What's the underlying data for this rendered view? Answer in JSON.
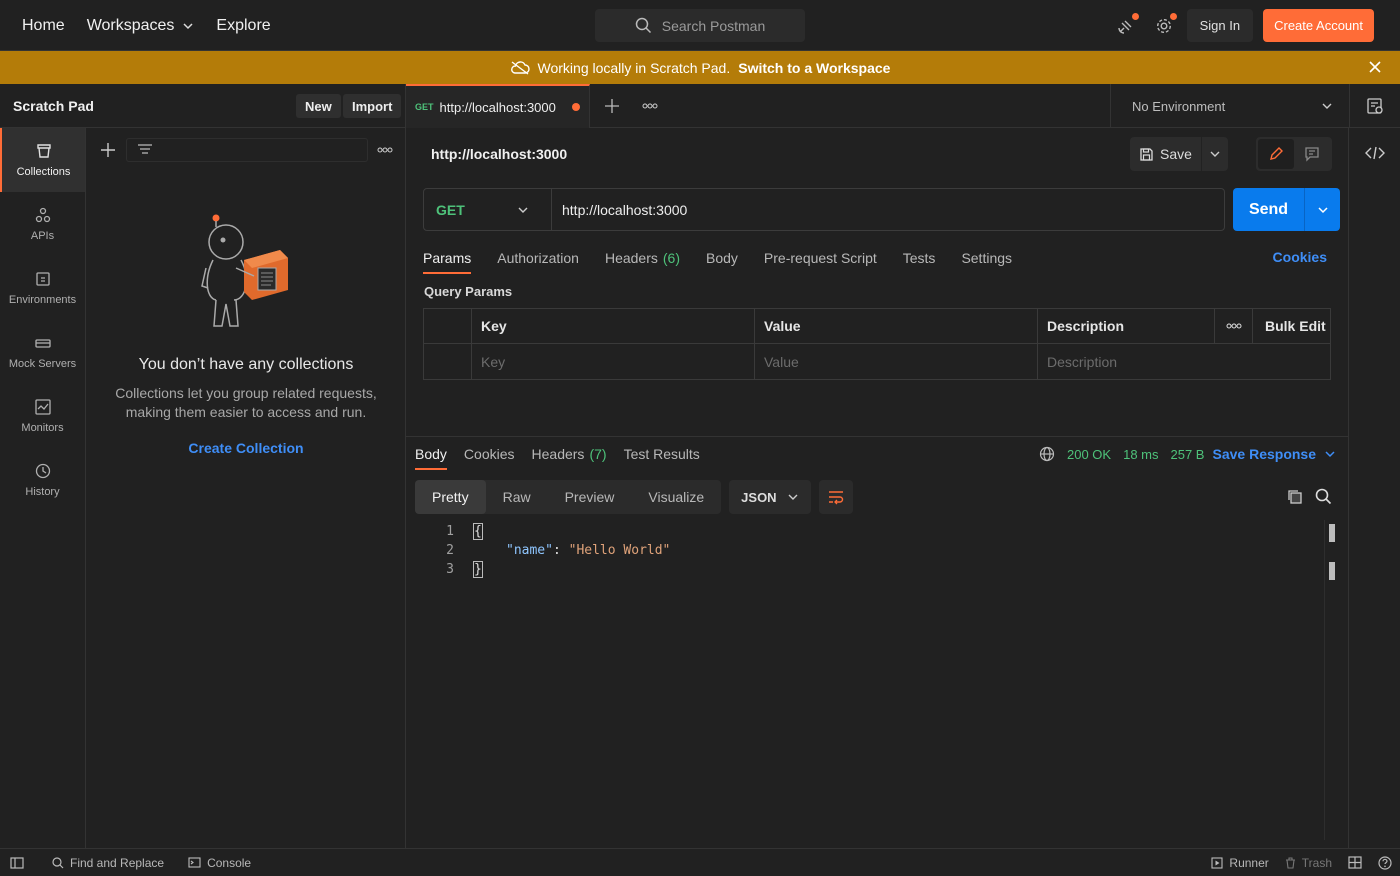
{
  "topbar": {
    "nav": {
      "home": "Home",
      "workspaces": "Workspaces",
      "explore": "Explore"
    },
    "search_placeholder": "Search Postman",
    "signin": "Sign In",
    "create_account": "Create Account"
  },
  "banner": {
    "text": "Working locally in Scratch Pad.",
    "link": "Switch to a Workspace"
  },
  "sidebar": {
    "title": "Scratch Pad",
    "new_label": "New",
    "import_label": "Import",
    "rail": [
      {
        "label": "Collections",
        "icon": "collections-icon"
      },
      {
        "label": "APIs",
        "icon": "apis-icon"
      },
      {
        "label": "Environments",
        "icon": "environments-icon"
      },
      {
        "label": "Mock Servers",
        "icon": "mock-servers-icon"
      },
      {
        "label": "Monitors",
        "icon": "monitors-icon"
      },
      {
        "label": "History",
        "icon": "history-icon"
      }
    ],
    "empty": {
      "heading": "You don’t have any collections",
      "body": "Collections let you group related requests, making them easier to access and run.",
      "cta": "Create Collection"
    }
  },
  "tabs": {
    "active": {
      "method": "GET",
      "url": "http://localhost:3000"
    },
    "environment": "No Environment"
  },
  "request": {
    "title": "http://localhost:3000",
    "save": "Save",
    "method": "GET",
    "url": "http://localhost:3000",
    "send": "Send",
    "tabs": [
      {
        "label": "Params",
        "count": ""
      },
      {
        "label": "Authorization",
        "count": ""
      },
      {
        "label": "Headers",
        "count": "(6)"
      },
      {
        "label": "Body",
        "count": ""
      },
      {
        "label": "Pre-request Script",
        "count": ""
      },
      {
        "label": "Tests",
        "count": ""
      },
      {
        "label": "Settings",
        "count": ""
      }
    ],
    "cookies": "Cookies",
    "query_params_label": "Query Params",
    "table": {
      "headers": [
        "Key",
        "Value",
        "Description"
      ],
      "bulk_edit": "Bulk Edit",
      "placeholders": [
        "Key",
        "Value",
        "Description"
      ]
    }
  },
  "response": {
    "tabs": [
      {
        "label": "Body",
        "count": ""
      },
      {
        "label": "Cookies",
        "count": ""
      },
      {
        "label": "Headers",
        "count": "(7)"
      },
      {
        "label": "Test Results",
        "count": ""
      }
    ],
    "status": "200 OK",
    "time": "18 ms",
    "size": "257 B",
    "save_response": "Save Response",
    "views": [
      "Pretty",
      "Raw",
      "Preview",
      "Visualize"
    ],
    "format": "JSON",
    "lines": [
      {
        "n": "1",
        "text": "{"
      },
      {
        "n": "2",
        "key": "\"name\"",
        "value": "\"Hello World\""
      },
      {
        "n": "3",
        "text": "}"
      }
    ]
  },
  "footer": {
    "find_replace": "Find and Replace",
    "console": "Console",
    "runner": "Runner",
    "trash": "Trash"
  },
  "colors": {
    "accent": "#ff6c37",
    "send": "#097bed",
    "banner": "#b47c09",
    "get": "#4ec27a",
    "link": "#3f8ef7"
  }
}
